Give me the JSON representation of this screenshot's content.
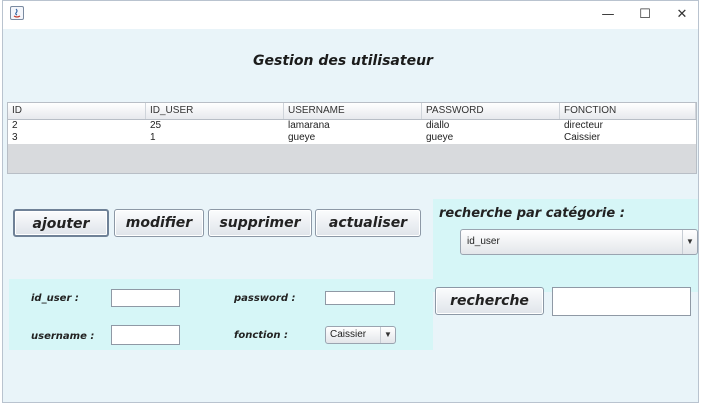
{
  "window": {
    "app_icon": "java-icon",
    "controls": {
      "minimize": "—",
      "maximize": "☐",
      "close": "✕"
    }
  },
  "title": "Gestion des utilisateur",
  "table": {
    "headers": [
      "ID",
      "ID_USER",
      "USERNAME",
      "PASSWORD",
      "FONCTION"
    ],
    "rows": [
      [
        "2",
        "25",
        "lamarana",
        "diallo",
        "directeur"
      ],
      [
        "3",
        "1",
        "gueye",
        "gueye",
        "Caissier"
      ]
    ]
  },
  "actions": {
    "ajouter": "ajouter",
    "modifier": "modifier",
    "supprimer": "supprimer",
    "actualiser": "actualiser"
  },
  "search": {
    "label": "recherche par catégorie :",
    "category_selected": "id_user",
    "button_label": "recherche",
    "query_value": ""
  },
  "form": {
    "id_user_label": "id_user :",
    "id_user_value": "",
    "password_label": "password :",
    "password_value": "",
    "username_label": "username :",
    "username_value": "",
    "fonction_label": "fonction :",
    "fonction_selected": "Caissier"
  },
  "colors": {
    "panel": "#d6f6f7",
    "content_bg": "#e9f4f9"
  }
}
